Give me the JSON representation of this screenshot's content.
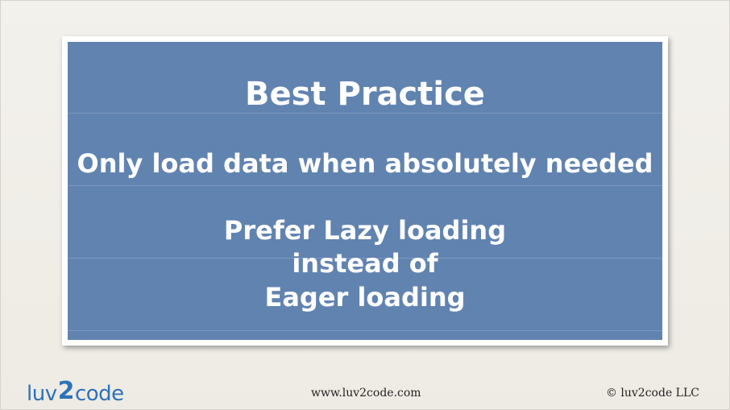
{
  "slide": {
    "title": "Best Practice",
    "lines": [
      "Only load data when absolutely needed",
      "Prefer Lazy loading",
      "instead of",
      "Eager loading"
    ]
  },
  "footer": {
    "logo_left": "luv",
    "logo_mid": "2",
    "logo_right": "code",
    "url": "www.luv2code.com",
    "copyright": "© luv2code LLC"
  },
  "colors": {
    "panel": "#6183b0",
    "logo": "#2d72b8",
    "background": "#f1efe9"
  }
}
